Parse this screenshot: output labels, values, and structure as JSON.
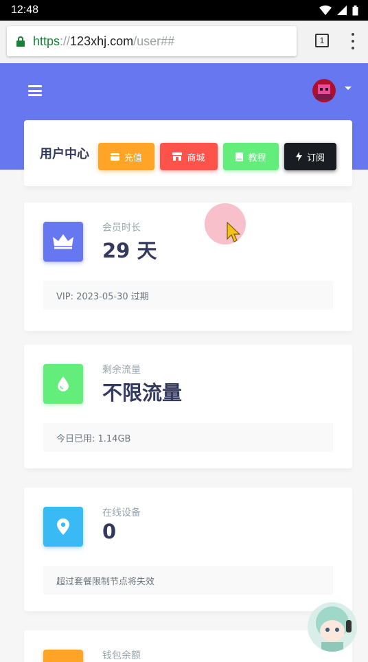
{
  "statusbar": {
    "time": "12:48"
  },
  "browser": {
    "url_scheme": "https",
    "url_sep": "://",
    "url_host": "123xhj.com",
    "url_path": "/user##",
    "tab_count": "1"
  },
  "header": {
    "title": "用户中心",
    "buttons": [
      {
        "label": "充值",
        "color": "#ffa426",
        "icon": "wallet-icon"
      },
      {
        "label": "商城",
        "color": "#fc544b",
        "icon": "store-icon"
      },
      {
        "label": "教程",
        "color": "#63ed7a",
        "icon": "book-icon"
      },
      {
        "label": "订阅",
        "color": "#191d21",
        "icon": "bolt-icon"
      }
    ]
  },
  "cards": [
    {
      "label": "会员时长",
      "value": "29 天",
      "footer": "VIP: 2023-05-30 过期",
      "icon": "crown-icon",
      "color": "#6777ef"
    },
    {
      "label": "剩余流量",
      "value": "不限流量",
      "footer": "今日已用: 1.14GB",
      "icon": "droplet-icon",
      "color": "#63ed7a"
    },
    {
      "label": "在线设备",
      "value": "0",
      "footer": "超过套餐限制节点将失效",
      "icon": "map-marker-icon",
      "color": "#3abaf4"
    },
    {
      "label": "钱包余额",
      "value": "",
      "footer": "",
      "icon": "wallet-icon",
      "color": "#ffa426"
    }
  ]
}
